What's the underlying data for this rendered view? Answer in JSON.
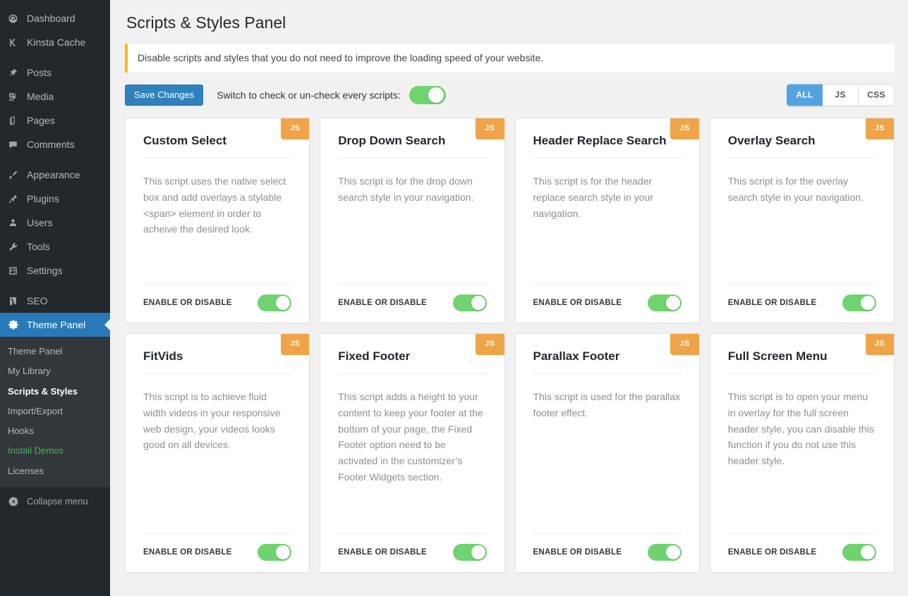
{
  "sidebar": {
    "items": [
      {
        "label": "Dashboard",
        "icon": "dashboard-icon"
      },
      {
        "label": "Kinsta Cache",
        "icon": "kinsta-k-icon"
      },
      {
        "label": "Posts",
        "icon": "pin-icon"
      },
      {
        "label": "Media",
        "icon": "media-icon"
      },
      {
        "label": "Pages",
        "icon": "pages-icon"
      },
      {
        "label": "Comments",
        "icon": "comment-icon"
      },
      {
        "label": "Appearance",
        "icon": "paintbrush-icon"
      },
      {
        "label": "Plugins",
        "icon": "plug-icon"
      },
      {
        "label": "Users",
        "icon": "user-icon"
      },
      {
        "label": "Tools",
        "icon": "wrench-icon"
      },
      {
        "label": "Settings",
        "icon": "sliders-icon"
      },
      {
        "label": "SEO",
        "icon": "yoast-seo-icon"
      },
      {
        "label": "Theme Panel",
        "icon": "gear-icon"
      }
    ],
    "submenu": [
      {
        "label": "Theme Panel"
      },
      {
        "label": "My Library"
      },
      {
        "label": "Scripts & Styles"
      },
      {
        "label": "Import/Export"
      },
      {
        "label": "Hooks"
      },
      {
        "label": "Install Demos"
      },
      {
        "label": "Licenses"
      }
    ],
    "collapse_label": "Collapse menu",
    "active_item": "Theme Panel",
    "current_submenu": "Scripts & Styles",
    "colors": {
      "background": "#23282d",
      "submenu_background": "#32373c",
      "active": "#2879b9",
      "highlight_green": "#46b450"
    }
  },
  "header": {
    "title": "Scripts & Styles Panel",
    "notice": "Disable scripts and styles that you do not need to improve the loading speed of your website.",
    "notice_accent": "#ffb900"
  },
  "toolbar": {
    "save_label": "Save Changes",
    "switch_label": "Switch to check or un-check every scripts:",
    "master_toggle_on": true,
    "filters": [
      {
        "label": "ALL",
        "active": true
      },
      {
        "label": "JS",
        "active": false
      },
      {
        "label": "CSS",
        "active": false
      }
    ],
    "filter_active_color": "#55a2e0",
    "save_button_color": "#2e81bd"
  },
  "cards": {
    "toggle_label": "ENABLE OR DISABLE",
    "toggle_on_color": "#6fd46f",
    "badge_js_color": "#f0a44a",
    "items": [
      {
        "title": "Custom Select",
        "badge": "JS",
        "description": "This script uses the native select box and add overlays a stylable <span> element in order to acheive the desired look.",
        "enabled": true
      },
      {
        "title": "Drop Down Search",
        "badge": "JS",
        "description": "This script is for the drop down search style in your navigation.",
        "enabled": true
      },
      {
        "title": "Header Replace Search",
        "badge": "JS",
        "description": "This script is for the header replace search style in your navigation.",
        "enabled": true
      },
      {
        "title": "Overlay Search",
        "badge": "JS",
        "description": "This script is for the overlay search style in your navigation.",
        "enabled": true
      },
      {
        "title": "FitVids",
        "badge": "JS",
        "description": "This script is to achieve fluid width videos in your responsive web design, your videos looks good on all devices.",
        "enabled": true
      },
      {
        "title": "Fixed Footer",
        "badge": "JS",
        "description": "This script adds a height to your content to keep your footer at the bottom of your page, the Fixed Footer option need to be activated in the customizer’s Footer Widgets section.",
        "enabled": true
      },
      {
        "title": "Parallax Footer",
        "badge": "JS",
        "description": "This script is used for the parallax footer effect.",
        "enabled": true
      },
      {
        "title": "Full Screen Menu",
        "badge": "JS",
        "description": "This script is to open your menu in overlay for the full screen header style, you can disable this function if you do not use this header style.",
        "enabled": true
      }
    ]
  }
}
